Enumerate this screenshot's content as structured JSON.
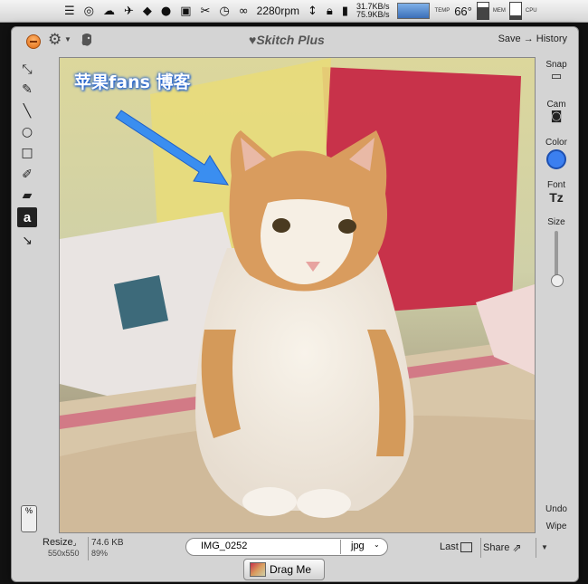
{
  "menubar": {
    "icons": [
      "wifi-menu-icon",
      "headphones-icon",
      "cloud-icon",
      "twitter-bird-icon",
      "dropbox-icon",
      "bowler-hat-icon",
      "clipboard-icon",
      "scissors-icon",
      "clock-icon",
      "infinity-icon"
    ],
    "rpm": "2280rpm",
    "net_up": "31.7KB/s",
    "net_down": "75.9KB/s",
    "temp_label": "TEMP",
    "temperature": "66°",
    "mem_label": "MEM",
    "cpu_label": "CPU"
  },
  "window": {
    "title": "Skitch Plus",
    "save_label": "Save",
    "arrow": "→",
    "history_label": "History"
  },
  "left_tools": [
    {
      "name": "select-tool",
      "glyph": "⤡"
    },
    {
      "name": "pen-tool",
      "glyph": "✎"
    },
    {
      "name": "line-tool",
      "glyph": "╲"
    },
    {
      "name": "ellipse-tool",
      "glyph": "○"
    },
    {
      "name": "rectangle-tool",
      "glyph": "□"
    },
    {
      "name": "highlighter-tool",
      "glyph": "✐"
    },
    {
      "name": "eraser-tool",
      "glyph": "▰"
    },
    {
      "name": "text-tool",
      "glyph": "a"
    },
    {
      "name": "arrow-tool",
      "glyph": "↘"
    }
  ],
  "canvas": {
    "annotation_text": "苹果fans 博客",
    "arrow_color": "#3a8ef0"
  },
  "right_panel": {
    "snap": "Snap",
    "cam": "Cam",
    "color": "Color",
    "color_value": "#3b7ff0",
    "font": "Font",
    "font_glyph": "Tz",
    "size": "Size",
    "undo": "Undo",
    "wipe": "Wipe"
  },
  "bottom": {
    "percent_toggle": "%",
    "resize": "Resize",
    "dimensions": "550x550",
    "file_size": "74.6 KB",
    "quality": "89%",
    "filename": "IMG_0252",
    "format": "jpg",
    "last": "Last",
    "share": "Share",
    "drag_me": "Drag Me"
  }
}
